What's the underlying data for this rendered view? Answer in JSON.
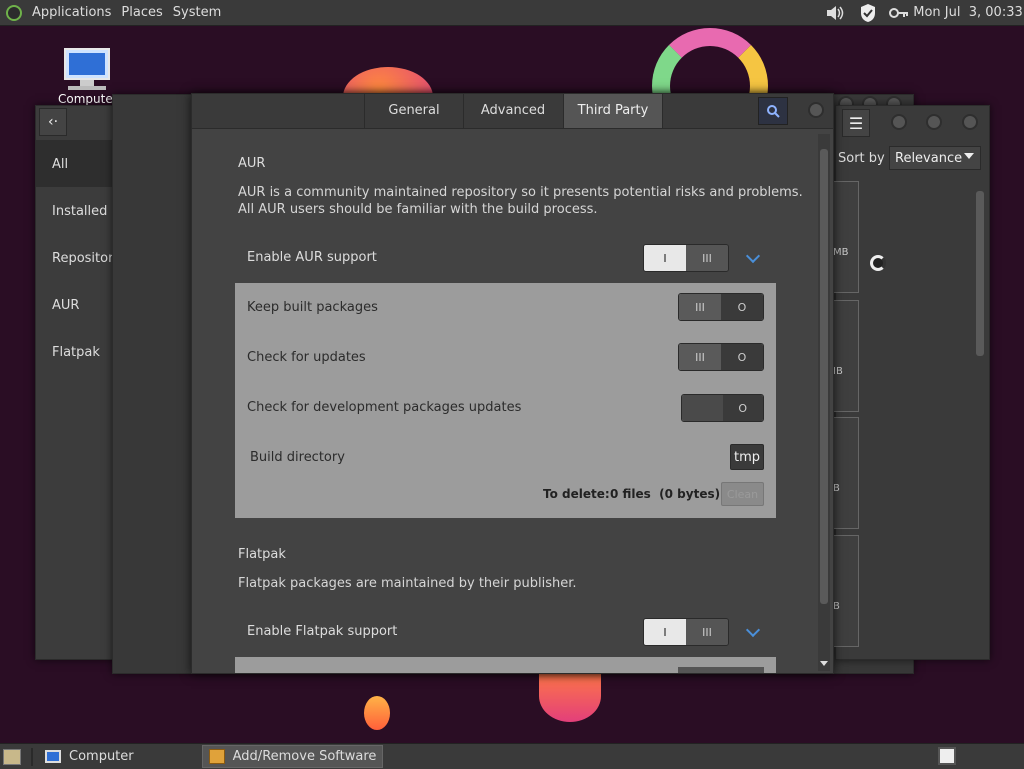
{
  "top_panel": {
    "menu": [
      "Applications",
      "Places",
      "System"
    ],
    "clock": "Mon Jul  3, 00:33"
  },
  "desktop": {
    "icon_label": "Computer"
  },
  "bottom_panel": {
    "tasks": [
      "Computer",
      "Add/Remove Software"
    ]
  },
  "sidebar": {
    "items": [
      "All",
      "Installed",
      "Repositories",
      "AUR",
      "Flatpak"
    ]
  },
  "right_window": {
    "sort_label": "Sort by",
    "sort_value": "Relevance",
    "size_fragments": [
      "MB",
      "IB",
      "B",
      "B"
    ]
  },
  "dialog": {
    "tabs": [
      "General",
      "Advanced",
      "Third Party"
    ],
    "aur": {
      "title": "AUR",
      "description_1": "AUR is a community maintained repository so it presents potential risks and problems.",
      "description_2": "All AUR users should be familiar with the build process.",
      "enable_label": "Enable AUR support",
      "keep_label": "Keep built packages",
      "updates_label": "Check for updates",
      "dev_label": "Check for development packages updates",
      "build_dir_label": "Build directory",
      "build_dir_value": "tmp",
      "to_delete_label": "To delete:",
      "to_delete_value": "0 files  (0 bytes)",
      "clean_button": "Clean"
    },
    "flatpak": {
      "title": "Flatpak",
      "description": "Flatpak packages are maintained by their publisher.",
      "enable_label": "Enable Flatpak support"
    },
    "switch_on_glyph": "I",
    "switch_grip_glyph": "III",
    "switch_off_glyph": "O"
  },
  "colors": {
    "desktop_bg": "#2a0d24",
    "panel_bg": "#3a3a3a",
    "window_bg": "#434343",
    "accent": "#4a8fd9"
  }
}
